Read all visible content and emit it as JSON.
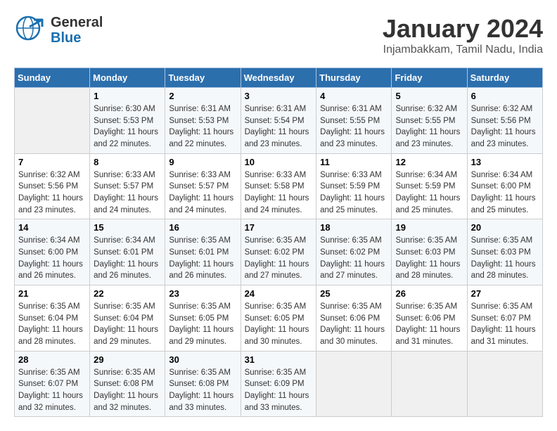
{
  "header": {
    "logo_general": "General",
    "logo_blue": "Blue",
    "title": "January 2024",
    "subtitle": "Injambakkam, Tamil Nadu, India"
  },
  "calendar": {
    "days_of_week": [
      "Sunday",
      "Monday",
      "Tuesday",
      "Wednesday",
      "Thursday",
      "Friday",
      "Saturday"
    ],
    "weeks": [
      [
        {
          "num": "",
          "sunrise": "",
          "sunset": "",
          "daylight": ""
        },
        {
          "num": "1",
          "sunrise": "Sunrise: 6:30 AM",
          "sunset": "Sunset: 5:53 PM",
          "daylight": "Daylight: 11 hours and 22 minutes."
        },
        {
          "num": "2",
          "sunrise": "Sunrise: 6:31 AM",
          "sunset": "Sunset: 5:53 PM",
          "daylight": "Daylight: 11 hours and 22 minutes."
        },
        {
          "num": "3",
          "sunrise": "Sunrise: 6:31 AM",
          "sunset": "Sunset: 5:54 PM",
          "daylight": "Daylight: 11 hours and 23 minutes."
        },
        {
          "num": "4",
          "sunrise": "Sunrise: 6:31 AM",
          "sunset": "Sunset: 5:55 PM",
          "daylight": "Daylight: 11 hours and 23 minutes."
        },
        {
          "num": "5",
          "sunrise": "Sunrise: 6:32 AM",
          "sunset": "Sunset: 5:55 PM",
          "daylight": "Daylight: 11 hours and 23 minutes."
        },
        {
          "num": "6",
          "sunrise": "Sunrise: 6:32 AM",
          "sunset": "Sunset: 5:56 PM",
          "daylight": "Daylight: 11 hours and 23 minutes."
        }
      ],
      [
        {
          "num": "7",
          "sunrise": "Sunrise: 6:32 AM",
          "sunset": "Sunset: 5:56 PM",
          "daylight": "Daylight: 11 hours and 23 minutes."
        },
        {
          "num": "8",
          "sunrise": "Sunrise: 6:33 AM",
          "sunset": "Sunset: 5:57 PM",
          "daylight": "Daylight: 11 hours and 24 minutes."
        },
        {
          "num": "9",
          "sunrise": "Sunrise: 6:33 AM",
          "sunset": "Sunset: 5:57 PM",
          "daylight": "Daylight: 11 hours and 24 minutes."
        },
        {
          "num": "10",
          "sunrise": "Sunrise: 6:33 AM",
          "sunset": "Sunset: 5:58 PM",
          "daylight": "Daylight: 11 hours and 24 minutes."
        },
        {
          "num": "11",
          "sunrise": "Sunrise: 6:33 AM",
          "sunset": "Sunset: 5:59 PM",
          "daylight": "Daylight: 11 hours and 25 minutes."
        },
        {
          "num": "12",
          "sunrise": "Sunrise: 6:34 AM",
          "sunset": "Sunset: 5:59 PM",
          "daylight": "Daylight: 11 hours and 25 minutes."
        },
        {
          "num": "13",
          "sunrise": "Sunrise: 6:34 AM",
          "sunset": "Sunset: 6:00 PM",
          "daylight": "Daylight: 11 hours and 25 minutes."
        }
      ],
      [
        {
          "num": "14",
          "sunrise": "Sunrise: 6:34 AM",
          "sunset": "Sunset: 6:00 PM",
          "daylight": "Daylight: 11 hours and 26 minutes."
        },
        {
          "num": "15",
          "sunrise": "Sunrise: 6:34 AM",
          "sunset": "Sunset: 6:01 PM",
          "daylight": "Daylight: 11 hours and 26 minutes."
        },
        {
          "num": "16",
          "sunrise": "Sunrise: 6:35 AM",
          "sunset": "Sunset: 6:01 PM",
          "daylight": "Daylight: 11 hours and 26 minutes."
        },
        {
          "num": "17",
          "sunrise": "Sunrise: 6:35 AM",
          "sunset": "Sunset: 6:02 PM",
          "daylight": "Daylight: 11 hours and 27 minutes."
        },
        {
          "num": "18",
          "sunrise": "Sunrise: 6:35 AM",
          "sunset": "Sunset: 6:02 PM",
          "daylight": "Daylight: 11 hours and 27 minutes."
        },
        {
          "num": "19",
          "sunrise": "Sunrise: 6:35 AM",
          "sunset": "Sunset: 6:03 PM",
          "daylight": "Daylight: 11 hours and 28 minutes."
        },
        {
          "num": "20",
          "sunrise": "Sunrise: 6:35 AM",
          "sunset": "Sunset: 6:03 PM",
          "daylight": "Daylight: 11 hours and 28 minutes."
        }
      ],
      [
        {
          "num": "21",
          "sunrise": "Sunrise: 6:35 AM",
          "sunset": "Sunset: 6:04 PM",
          "daylight": "Daylight: 11 hours and 28 minutes."
        },
        {
          "num": "22",
          "sunrise": "Sunrise: 6:35 AM",
          "sunset": "Sunset: 6:04 PM",
          "daylight": "Daylight: 11 hours and 29 minutes."
        },
        {
          "num": "23",
          "sunrise": "Sunrise: 6:35 AM",
          "sunset": "Sunset: 6:05 PM",
          "daylight": "Daylight: 11 hours and 29 minutes."
        },
        {
          "num": "24",
          "sunrise": "Sunrise: 6:35 AM",
          "sunset": "Sunset: 6:05 PM",
          "daylight": "Daylight: 11 hours and 30 minutes."
        },
        {
          "num": "25",
          "sunrise": "Sunrise: 6:35 AM",
          "sunset": "Sunset: 6:06 PM",
          "daylight": "Daylight: 11 hours and 30 minutes."
        },
        {
          "num": "26",
          "sunrise": "Sunrise: 6:35 AM",
          "sunset": "Sunset: 6:06 PM",
          "daylight": "Daylight: 11 hours and 31 minutes."
        },
        {
          "num": "27",
          "sunrise": "Sunrise: 6:35 AM",
          "sunset": "Sunset: 6:07 PM",
          "daylight": "Daylight: 11 hours and 31 minutes."
        }
      ],
      [
        {
          "num": "28",
          "sunrise": "Sunrise: 6:35 AM",
          "sunset": "Sunset: 6:07 PM",
          "daylight": "Daylight: 11 hours and 32 minutes."
        },
        {
          "num": "29",
          "sunrise": "Sunrise: 6:35 AM",
          "sunset": "Sunset: 6:08 PM",
          "daylight": "Daylight: 11 hours and 32 minutes."
        },
        {
          "num": "30",
          "sunrise": "Sunrise: 6:35 AM",
          "sunset": "Sunset: 6:08 PM",
          "daylight": "Daylight: 11 hours and 33 minutes."
        },
        {
          "num": "31",
          "sunrise": "Sunrise: 6:35 AM",
          "sunset": "Sunset: 6:09 PM",
          "daylight": "Daylight: 11 hours and 33 minutes."
        },
        {
          "num": "",
          "sunrise": "",
          "sunset": "",
          "daylight": ""
        },
        {
          "num": "",
          "sunrise": "",
          "sunset": "",
          "daylight": ""
        },
        {
          "num": "",
          "sunrise": "",
          "sunset": "",
          "daylight": ""
        }
      ]
    ]
  }
}
